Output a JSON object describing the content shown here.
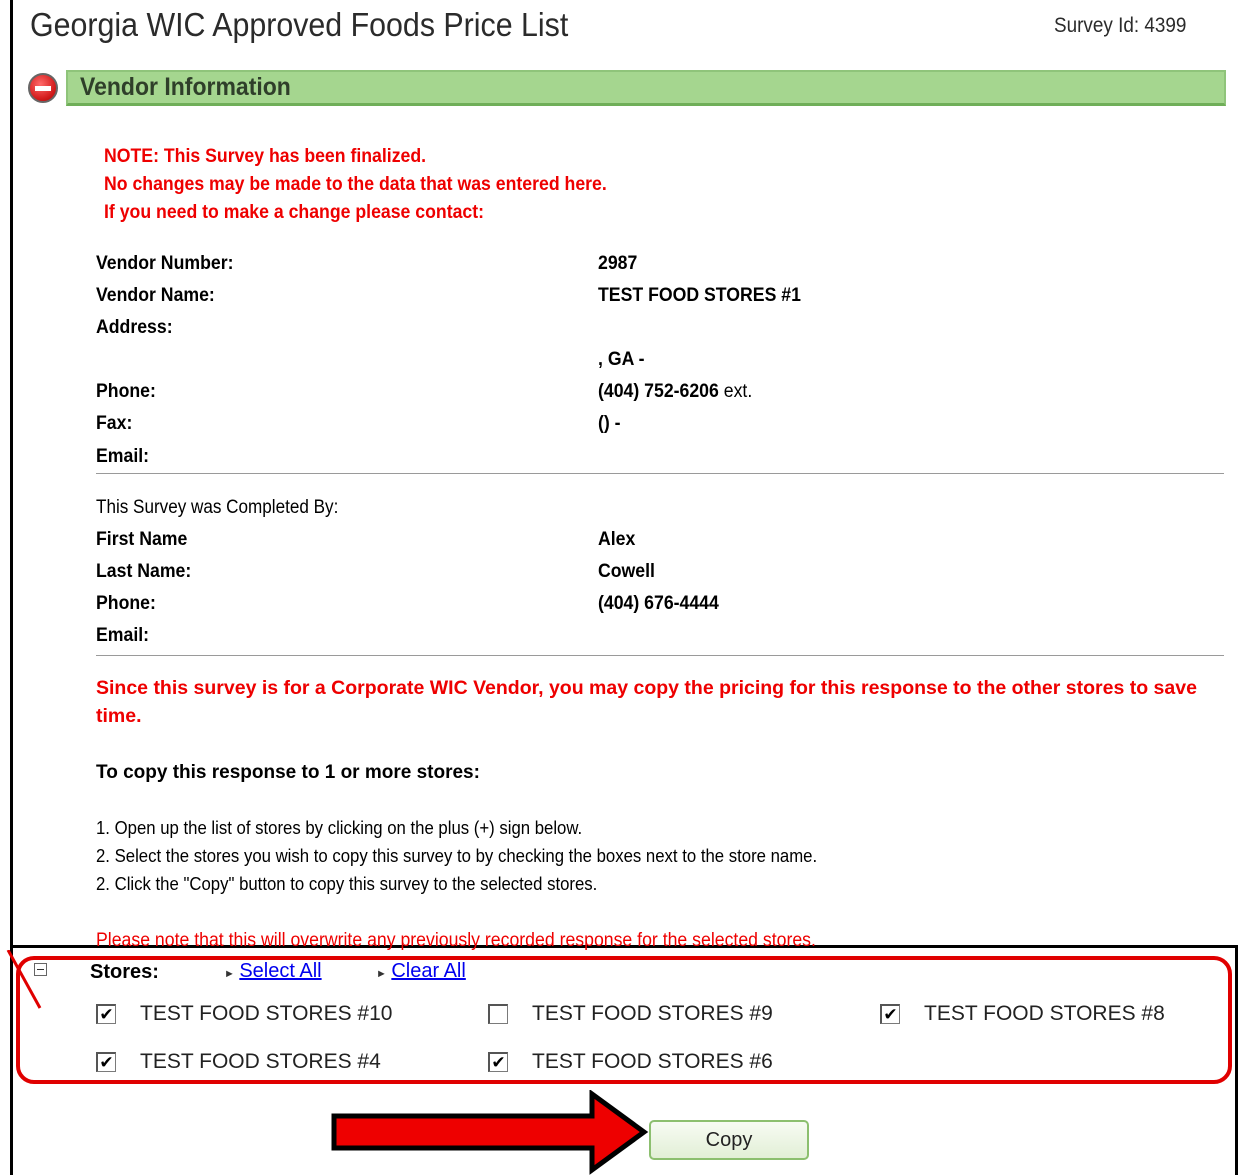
{
  "header": {
    "title": "Georgia WIC Approved Foods Price List",
    "survey_id": "Survey Id: 4399"
  },
  "section": {
    "title": "Vendor Information"
  },
  "notice": {
    "line1": "NOTE: This Survey has been finalized.",
    "line2": "No changes may be made to the data that was entered here.",
    "line3": "If you need to make a change please contact:"
  },
  "vendor": {
    "number_label": "Vendor Number:",
    "number": "2987",
    "name_label": "Vendor Name:",
    "name": "TEST FOOD STORES #1",
    "address_label": "Address:",
    "address_line2": ", GA  -",
    "phone_label": "Phone:",
    "phone": "(404) 752-6206",
    "phone_ext": " ext.",
    "fax_label": "Fax:",
    "fax": "() -",
    "email_label": "Email:"
  },
  "completed_by": {
    "heading": "This Survey was Completed By:",
    "first_name_label": "First Name",
    "first_name": "Alex",
    "last_name_label": "Last Name:",
    "last_name": "Cowell",
    "phone_label": "Phone:",
    "phone": "(404) 676-4444",
    "email_label": "Email:"
  },
  "corporate_note": "Since this survey is for a Corporate WIC Vendor, you may copy the pricing for this response to the other stores to save time.",
  "copy_instructions": {
    "heading": "To copy this response to 1 or more stores:",
    "step1": "1. Open up the list of stores by clicking on the plus (+) sign below.",
    "step2": "2. Select the stores you wish to copy this survey to by checking the boxes next to the store name.",
    "step3": "2. Click the \"Copy\" button to copy this survey to the selected stores."
  },
  "overwrite_note": "Please note that this will overwrite any previously recorded response for the selected stores.",
  "stores_panel": {
    "label": "Stores:",
    "select_all": "Select All",
    "clear_all": "Clear All",
    "stores": [
      {
        "name": "TEST FOOD STORES #10",
        "checked": true
      },
      {
        "name": "TEST FOOD STORES #9",
        "checked": false
      },
      {
        "name": "TEST FOOD STORES #8",
        "checked": true
      },
      {
        "name": "TEST FOOD STORES #4",
        "checked": true
      },
      {
        "name": "TEST FOOD STORES #6",
        "checked": true
      }
    ]
  },
  "copy_button": "Copy",
  "colors": {
    "notice_red": "#ee0000",
    "section_green": "#a5d68f",
    "highlight_red": "#e00000",
    "link_blue": "#0000ee"
  }
}
